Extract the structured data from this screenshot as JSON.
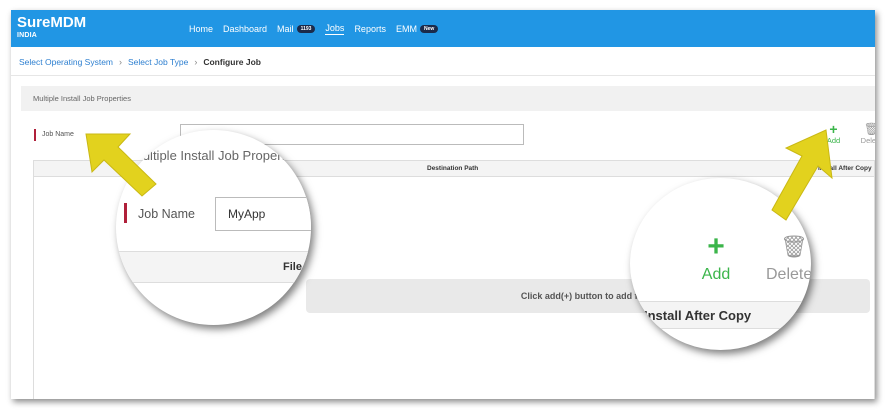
{
  "app": {
    "brand": "SureMDM",
    "region": "INDIA"
  },
  "nav": {
    "items": [
      {
        "label": "Home"
      },
      {
        "label": "Dashboard"
      },
      {
        "label": "Mail",
        "badge": "1193"
      },
      {
        "label": "Jobs"
      },
      {
        "label": "Reports"
      },
      {
        "label": "EMM",
        "badge": "New"
      }
    ],
    "active": "Jobs"
  },
  "breadcrumb": [
    "Select Operating System",
    "Select Job Type",
    "Configure Job"
  ],
  "section": {
    "title": "Multiple Install Job Properties"
  },
  "form": {
    "job_name_label": "Job Name",
    "job_name_value": "MyApp"
  },
  "actions": {
    "add": "Add",
    "delete": "Delete"
  },
  "table": {
    "columns": [
      "File",
      "Destination Path",
      "Install After Copy"
    ],
    "empty_message": "Click add(+) button to add files."
  },
  "magnifier_left": {
    "title": "Multiple Install Job Properties"
  },
  "colors": {
    "topbar": "#2196e4",
    "add_green": "#3bb54a",
    "required_marker": "#b0203a",
    "arrow_yellow": "#e2d21e"
  }
}
